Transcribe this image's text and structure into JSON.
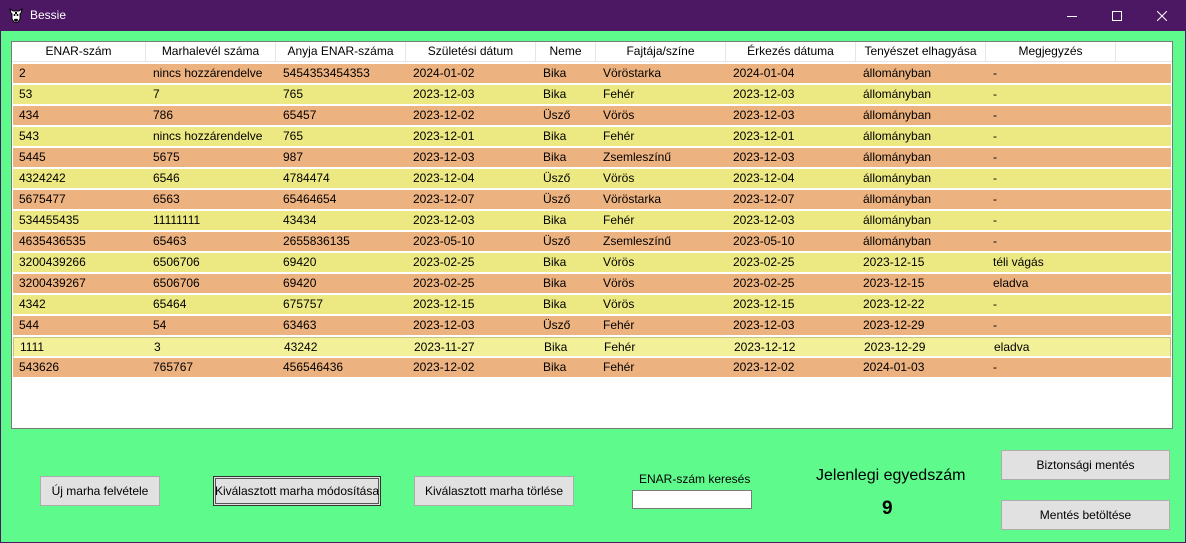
{
  "window": {
    "title": "Bessie",
    "app_icon": "cow-icon",
    "controls": [
      "minimize-icon",
      "maximize-icon",
      "close-icon"
    ]
  },
  "grid": {
    "columns": [
      "ENAR-szám",
      "Marhalevél száma",
      "Anyja ENAR-száma",
      "Születési dátum",
      "Neme",
      "Fajtája/színe",
      "Érkezés dátuma",
      "Tenyészet elhagyása",
      "Megjegyzés"
    ],
    "rows": [
      [
        "2",
        "nincs hozzárendelve",
        "5454353454353",
        "2024-01-02",
        "Bika",
        "Vöröstarka",
        "2024-01-04",
        "állományban",
        "-"
      ],
      [
        "53",
        "7",
        "765",
        "2023-12-03",
        "Bika",
        "Fehér",
        "2023-12-03",
        "állományban",
        "-"
      ],
      [
        "434",
        "786",
        "65457",
        "2023-12-02",
        "Üsző",
        "Vörös",
        "2023-12-03",
        "állományban",
        "-"
      ],
      [
        "543",
        "nincs hozzárendelve",
        "765",
        "2023-12-01",
        "Bika",
        "Fehér",
        "2023-12-01",
        "állományban",
        "-"
      ],
      [
        "5445",
        "5675",
        "987",
        "2023-12-03",
        "Bika",
        "Zsemleszínű",
        "2023-12-03",
        "állományban",
        "-"
      ],
      [
        "4324242",
        "6546",
        "4784474",
        "2023-12-04",
        "Üsző",
        "Vörös",
        "2023-12-04",
        "állományban",
        "-"
      ],
      [
        "5675477",
        "6563",
        "65464654",
        "2023-12-07",
        "Üsző",
        "Vöröstarka",
        "2023-12-07",
        "állományban",
        "-"
      ],
      [
        "534455435",
        "11111111",
        "43434",
        "2023-12-03",
        "Bika",
        "Fehér",
        "2023-12-03",
        "állományban",
        "-"
      ],
      [
        "4635436535",
        "65463",
        "2655836135",
        "2023-05-10",
        "Üsző",
        "Zsemleszínű",
        "2023-05-10",
        "állományban",
        "-"
      ],
      [
        "3200439266",
        "6506706",
        "69420",
        "2023-02-25",
        "Bika",
        "Vörös",
        "2023-02-25",
        "2023-12-15",
        "téli vágás"
      ],
      [
        "3200439267",
        "6506706",
        "69420",
        "2023-02-25",
        "Bika",
        "Vörös",
        "2023-02-25",
        "2023-12-15",
        "eladva"
      ],
      [
        "4342",
        "65464",
        "675757",
        "2023-12-15",
        "Bika",
        "Vörös",
        "2023-12-15",
        "2023-12-22",
        "-"
      ],
      [
        "544",
        "54",
        "63463",
        "2023-12-03",
        "Üsző",
        "Fehér",
        "2023-12-03",
        "2023-12-29",
        "-"
      ],
      [
        "1111",
        "3",
        "43242",
        "2023-11-27",
        "Bika",
        "Fehér",
        "2023-12-12",
        "2023-12-29",
        "eladva"
      ],
      [
        "543626",
        "765767",
        "456546436",
        "2023-12-02",
        "Bika",
        "Fehér",
        "2023-12-02",
        "2024-01-03",
        "-"
      ]
    ],
    "selected_row": 13
  },
  "buttons": {
    "new": "Új marha felvétele",
    "modify": "Kiválasztott marha módosítása",
    "delete": "Kiválasztott marha törlése",
    "backup": "Biztonsági mentés",
    "load": "Mentés betöltése"
  },
  "search": {
    "label": "ENAR-szám keresés",
    "value": ""
  },
  "count": {
    "label": "Jelenlegi egyedszám",
    "value": "9"
  },
  "colors": {
    "titlebar": "#4c1763",
    "background": "#5ffa8c",
    "row_even": "#ecb27f",
    "row_odd": "#ede982"
  }
}
